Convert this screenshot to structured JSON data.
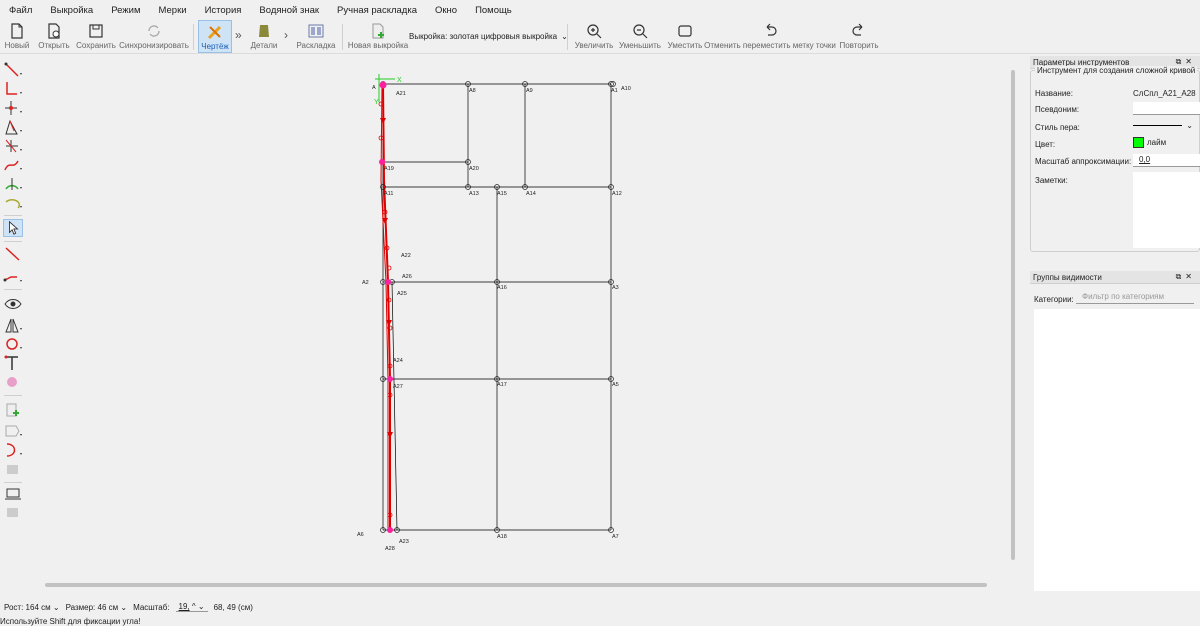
{
  "menu": [
    "Файл",
    "Выкройка",
    "Режим",
    "Мерки",
    "История",
    "Водяной знак",
    "Ручная раскладка",
    "Окно",
    "Помощь"
  ],
  "toolbar": {
    "new": "Новый",
    "open": "Открыть",
    "save": "Сохранить",
    "sync": "Синхронизировать",
    "draft": "Чертёж",
    "details": "Детали",
    "layout": "Раскладка",
    "new_pattern": "Новая выкройка",
    "pattern_combo": "Выкройка: золотая цифровыя выкройка",
    "zoom_in": "Увеличить",
    "zoom_out": "Уменьшить",
    "fit": "Уместить",
    "undo": "Отменить переместить метку точки",
    "redo": "Повторить"
  },
  "tool_options": {
    "title": "Параметры инструментов",
    "group_title": "Инструмент для создания сложной кривой",
    "name_label": "Название:",
    "name_value": "СлСпл_А21_А28",
    "alias_label": "Псевдоним:",
    "pen_label": "Стиль пера:",
    "color_label": "Цвет:",
    "color_value": "лайм",
    "color_hex": "#00ff00",
    "approx_label": "Масштаб аппроксимации:",
    "approx_value": "0,0",
    "notes_label": "Заметки:"
  },
  "visibility": {
    "title": "Группы видимости",
    "categories_label": "Категории:",
    "filter_placeholder": "Фильтр по категориям"
  },
  "status": {
    "height": "Рост: 164 см",
    "size": "Размер: 46 см",
    "scale_label": "Масштаб:",
    "scale_value": "19,",
    "coords": "68, 49 (см)",
    "hint": "Используйте Shift для фиксации угла!"
  },
  "points": {
    "A": "А",
    "A1": "А1",
    "A2": "А2",
    "A3": "А3",
    "A5": "А5",
    "A6": "А6",
    "A7": "А7",
    "A8": "А8",
    "A9": "А9",
    "A10": "А10",
    "A11": "А11",
    "A12": "А12",
    "A13": "А13",
    "A14": "А14",
    "A15": "А15",
    "A16": "А16",
    "A17": "А17",
    "A18": "А18",
    "A19": "А19",
    "A20": "А20",
    "A21": "А21",
    "A22": "А22",
    "A23": "А23",
    "A24": "А24",
    "A25": "А25",
    "A26": "А26",
    "A27": "А27",
    "A28": "А28",
    "x_axis": "X",
    "y_axis": "Y"
  },
  "colors": {
    "curve": "#e00000",
    "accent_point": "#ff1fa0",
    "axis": "#22cc22",
    "line": "#000000"
  }
}
